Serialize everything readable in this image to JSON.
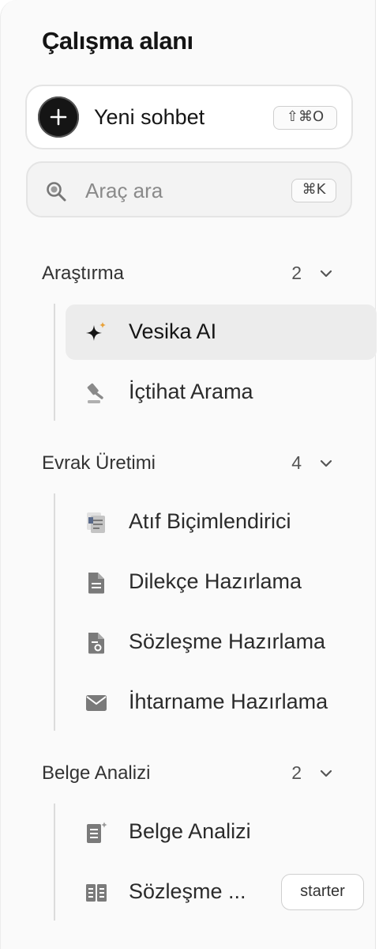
{
  "workspace": {
    "title": "Çalışma alanı"
  },
  "new_chat": {
    "label": "Yeni sohbet",
    "shortcut": "⇧⌘O"
  },
  "search": {
    "placeholder": "Araç ara",
    "shortcut": "⌘K"
  },
  "sections": [
    {
      "name": "Araştırma",
      "count": "2",
      "items": [
        {
          "label": "Vesika AI",
          "icon": "sparkle-icon",
          "active": true
        },
        {
          "label": "İçtihat Arama",
          "icon": "gavel-icon",
          "active": false
        }
      ]
    },
    {
      "name": "Evrak Üretimi",
      "count": "4",
      "items": [
        {
          "label": "Atıf Biçimlendirici",
          "icon": "document-stack-icon",
          "active": false
        },
        {
          "label": "Dilekçe Hazırlama",
          "icon": "document-icon",
          "active": false
        },
        {
          "label": "Sözleşme Hazırlama",
          "icon": "contract-document-icon",
          "active": false
        },
        {
          "label": "İhtarname Hazırlama",
          "icon": "envelope-icon",
          "active": false
        }
      ]
    },
    {
      "name": "Belge Analizi",
      "count": "2",
      "items": [
        {
          "label": "Belge Analizi",
          "icon": "document-sparkle-icon",
          "active": false
        },
        {
          "label": "Sözleşme ...",
          "icon": "compare-documents-icon",
          "active": false,
          "badge": "starter"
        }
      ]
    }
  ],
  "colors": {
    "accent_sparkle": "#e8a23a",
    "icon_gray": "#7a7a7a",
    "active_bg": "#ececec"
  }
}
